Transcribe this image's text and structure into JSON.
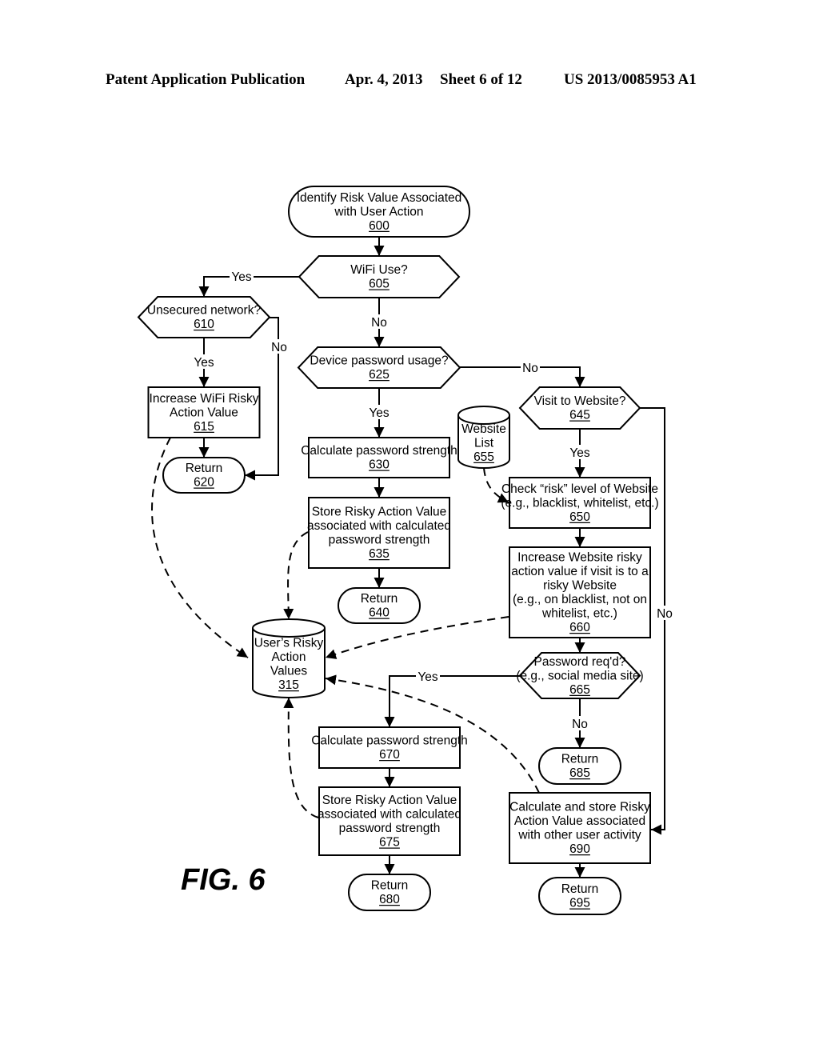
{
  "header": {
    "publication": "Patent Application Publication",
    "date": "Apr. 4, 2013",
    "sheet": "Sheet 6 of 12",
    "number": "US 2013/0085953 A1"
  },
  "figure_label": "FIG. 6",
  "nodes": {
    "n600": {
      "lines": [
        "Identify Risk Value Associated",
        "with User Action"
      ],
      "ref": "600",
      "shape": "terminator"
    },
    "n605": {
      "lines": [
        "WiFi Use?"
      ],
      "ref": "605",
      "shape": "decision"
    },
    "n610": {
      "lines": [
        "Unsecured network?"
      ],
      "ref": "610",
      "shape": "decision"
    },
    "n615": {
      "lines": [
        "Increase WiFi Risky",
        "Action Value"
      ],
      "ref": "615",
      "shape": "process"
    },
    "n620": {
      "lines": [
        "Return"
      ],
      "ref": "620",
      "shape": "terminator"
    },
    "n625": {
      "lines": [
        "Device password usage?"
      ],
      "ref": "625",
      "shape": "decision"
    },
    "n630": {
      "lines": [
        "Calculate password strength"
      ],
      "ref": "630",
      "shape": "process"
    },
    "n635": {
      "lines": [
        "Store Risky Action Value",
        "associated with calculated",
        "password strength"
      ],
      "ref": "635",
      "shape": "process"
    },
    "n640": {
      "lines": [
        "Return"
      ],
      "ref": "640",
      "shape": "terminator"
    },
    "n645": {
      "lines": [
        "Visit to Website?"
      ],
      "ref": "645",
      "shape": "decision"
    },
    "n650": {
      "lines": [
        "Check “risk” level of Website",
        "(e.g., blacklist, whitelist, etc.)"
      ],
      "ref": "650",
      "shape": "process"
    },
    "n655": {
      "lines": [
        "Website",
        "List"
      ],
      "ref": "655",
      "shape": "database"
    },
    "n660": {
      "lines": [
        "Increase Website risky",
        "action value if visit is to a",
        "risky Website",
        "(e.g., on blacklist, not on",
        "whitelist, etc.)"
      ],
      "ref": "660",
      "shape": "process"
    },
    "n665": {
      "lines": [
        "Password req'd?",
        "(e.g., social media site)"
      ],
      "ref": "665",
      "shape": "decision"
    },
    "n670": {
      "lines": [
        "Calculate password strength"
      ],
      "ref": "670",
      "shape": "process"
    },
    "n675": {
      "lines": [
        "Store Risky Action Value",
        "associated with calculated",
        "password strength"
      ],
      "ref": "675",
      "shape": "process"
    },
    "n680": {
      "lines": [
        "Return"
      ],
      "ref": "680",
      "shape": "terminator"
    },
    "n685": {
      "lines": [
        "Return"
      ],
      "ref": "685",
      "shape": "terminator"
    },
    "n690": {
      "lines": [
        "Calculate and store Risky",
        "Action Value associated",
        "with other user activity"
      ],
      "ref": "690",
      "shape": "process"
    },
    "n695": {
      "lines": [
        "Return"
      ],
      "ref": "695",
      "shape": "terminator"
    },
    "n315": {
      "lines": [
        "User’s Risky",
        "Action",
        "Values"
      ],
      "ref": "315",
      "shape": "database"
    }
  },
  "edge_labels": {
    "e605_yes": "Yes",
    "e605_no": "No",
    "e610_yes": "Yes",
    "e610_no": "No",
    "e625_yes": "Yes",
    "e625_no": "No",
    "e645_yes": "Yes",
    "e645_no": "No",
    "e665_yes": "Yes",
    "e665_no": "No"
  }
}
